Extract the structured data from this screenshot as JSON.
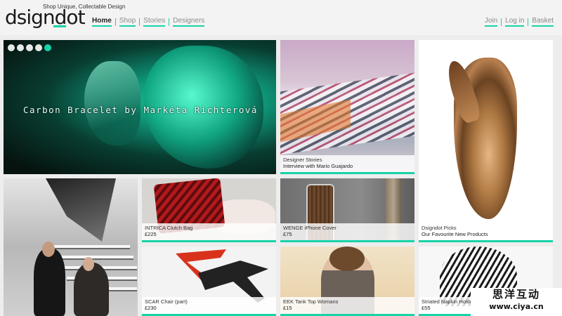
{
  "brand": {
    "logo": "dsigndot",
    "tagline": "Shop Unique, Collectable Design",
    "accent": "#17d3a8"
  },
  "nav_left": [
    "Home",
    "Shop",
    "Stories",
    "Designers"
  ],
  "nav_right": [
    "Join",
    "Log in",
    "Basket"
  ],
  "hero": {
    "title": "Carbon Bracelet by Markéta Richterová",
    "slide_count": 5,
    "active_slide": 5
  },
  "tiles": {
    "stories": {
      "line1": "Designer Stories",
      "line2": "Interview with Mario Guajardo"
    },
    "picks": {
      "line1": "Dsigndot Picks",
      "line2": "Our Favourite New Products"
    },
    "clutch": {
      "name": "INTRICA Clutch Bag",
      "price": "£225"
    },
    "wenge": {
      "name": "WENGE iPhone Cover",
      "price": "£75"
    },
    "scar": {
      "name": "SCAR Chair (part)",
      "price": "£230"
    },
    "eek": {
      "name": "EEK Tank Top Womans",
      "price": "£15"
    },
    "napkin": {
      "name": "Striated Napkin Holder",
      "price": "£55"
    }
  },
  "watermark": {
    "line1": "思洋互动",
    "line2": "www.ciya.cn"
  }
}
